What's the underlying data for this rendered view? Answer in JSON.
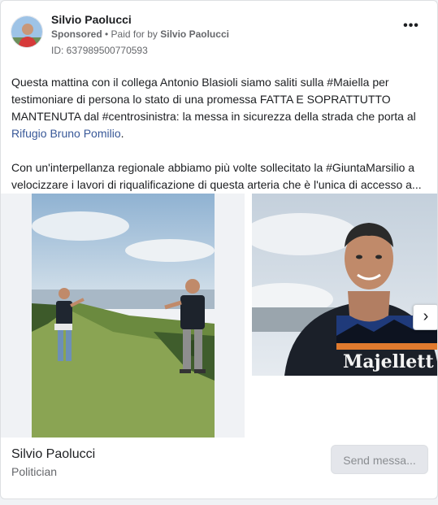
{
  "post": {
    "page_name": "Silvio Paolucci",
    "sponsored_label": "Sponsored",
    "separator": " • ",
    "paid_for_prefix": "Paid for by ",
    "paid_for_by": "Silvio Paolucci",
    "ad_id": "ID: 637989500770593",
    "more_icon": "•••",
    "text_line1": "Questa mattina con il collega Antonio Blasioli siamo saliti sulla #Maiella per",
    "text_line2": "testimoniare di persona lo stato di una promessa FATTA E SOPRATTUTTO",
    "text_line3": "MANTENUTA dal #centrosinistra: la messa in sicurezza della strada che porta al",
    "text_link": "Rifugio Bruno Pomilio",
    "text_link_suffix": ".",
    "text_para2_line1": "Con un'interpellanza regionale abbiamo più volte sollecitato la #GiuntaMarsilio a",
    "text_para2_line2": "velocizzare i lavori di riqualificazione di questa arteria che è l'unica di accesso a..."
  },
  "carousel": {
    "next_icon": "›",
    "shirt_text": "Majellett"
  },
  "footer": {
    "name": "Silvio Paolucci",
    "category": "Politician",
    "send_button": "Send messa..."
  },
  "colors": {
    "link": "#385898",
    "secondary_text": "#65676b",
    "button_bg": "#e4e6eb"
  }
}
